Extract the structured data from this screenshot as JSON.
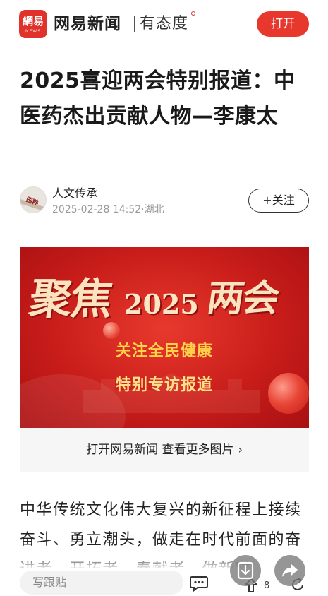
{
  "app_bar": {
    "logo_main": "網易",
    "logo_sub": "NEWS",
    "brand": "网易新闻",
    "slogan": "有态度",
    "open_button": "打开",
    "accent_color": "#e8372c"
  },
  "article": {
    "headline": "2025喜迎两会特别报道：中医药杰出贡献人物—李康太",
    "author": "人文传承",
    "meta": "2025-02-28 14:52·湖北",
    "follow_button": "+关注",
    "avatar_text": "国粹"
  },
  "banner": {
    "title_left": "聚焦",
    "title_year": "2025",
    "title_right": "两会",
    "subtitle_1": "关注全民健康",
    "subtitle_2": "特别专访报道"
  },
  "more_images": {
    "label": "打开网易新闻 查看更多图片",
    "chevron": "›"
  },
  "body": {
    "text": "中华传统文化伟大复兴的新征程上接续奋斗、勇立潮头，做走在时代前面的奋进者、开拓者、奉献者，做新时"
  },
  "toolbar": {
    "comment_placeholder": "写跟贴",
    "share_count": "8",
    "icons": [
      "comment-icon",
      "share-icon",
      "refresh-icon",
      "download-icon",
      "forward-icon"
    ]
  }
}
